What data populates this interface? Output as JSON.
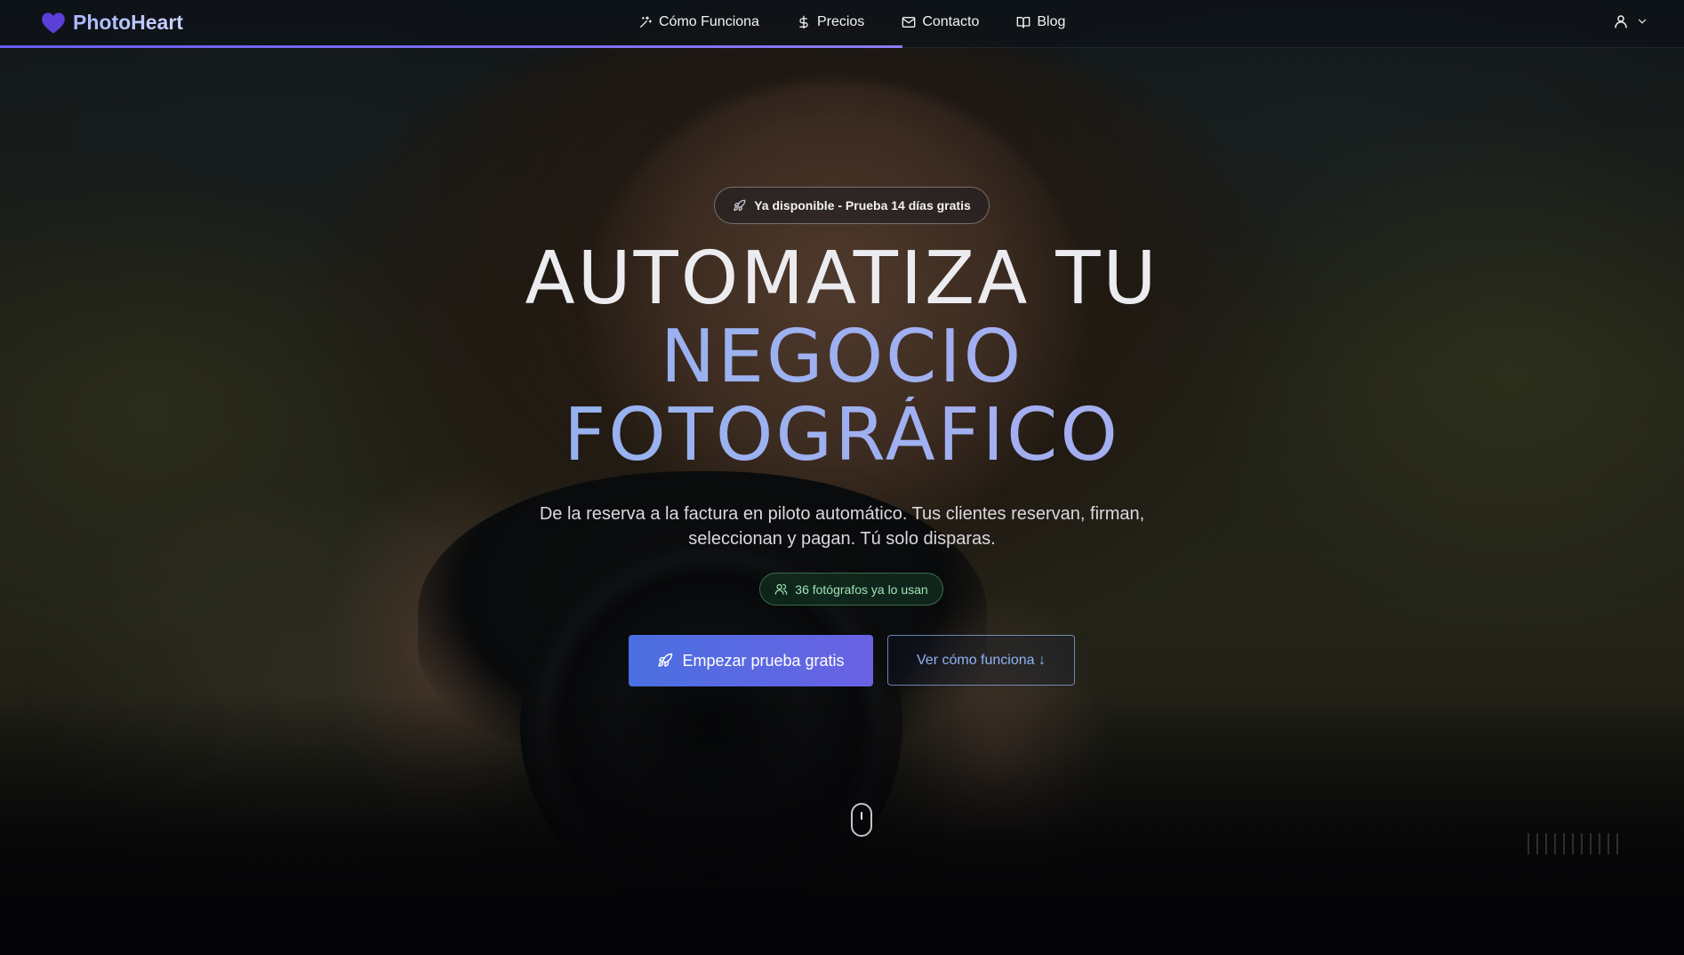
{
  "nav": {
    "brand": "PhotoHeart",
    "links": [
      {
        "label": "Cómo Funciona",
        "icon": "sparkles-icon"
      },
      {
        "label": "Precios",
        "icon": "dollar-icon"
      },
      {
        "label": "Contacto",
        "icon": "mail-icon"
      },
      {
        "label": "Blog",
        "icon": "book-icon"
      }
    ],
    "user_icon": "user-icon",
    "user_chevron": "chevron-down-icon",
    "scroll_progress_percent": 53.6
  },
  "hero": {
    "badge": "Ya disponible - Prueba 14 días gratis",
    "headline": [
      "AUTOMATIZA TU",
      "NEGOCIO",
      "FOTOGRÁFICO"
    ],
    "subtitle": "De la reserva a la factura en piloto automático. Tus clientes reservan, firman, seleccionan y pagan. Tú solo disparas.",
    "users_badge": "36 fotógrafos ya lo usan",
    "primary_cta": "Empezar prueba gratis",
    "secondary_cta": "Ver cómo funciona ↓",
    "slide_count": 11
  },
  "colors": {
    "brand_heart": "#5b3fd8",
    "accent": "#5a6ae2",
    "success_badge": "#9fe2b8"
  }
}
